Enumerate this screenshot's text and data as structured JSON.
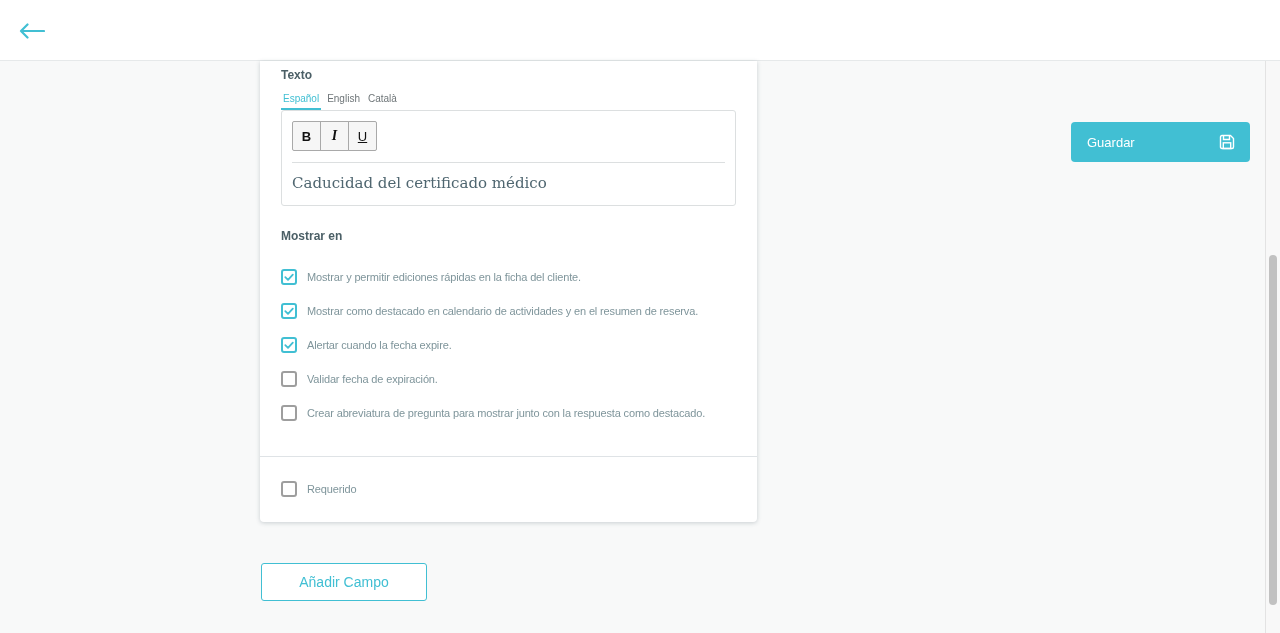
{
  "form_card": {
    "text_section": {
      "title": "Texto",
      "language_tabs": [
        {
          "label": "Español",
          "selected": true
        },
        {
          "label": "English",
          "selected": false
        },
        {
          "label": "Català",
          "selected": false
        }
      ],
      "toolbar": [
        {
          "label": "B",
          "kind": "bold"
        },
        {
          "label": "I",
          "kind": "italic"
        },
        {
          "label": "U",
          "kind": "underline"
        }
      ],
      "content": "Caducidad del certificado médico"
    },
    "display_section": {
      "title": "Mostrar en",
      "options": [
        {
          "label": "Mostrar y permitir ediciones rápidas en la ficha del cliente.",
          "checked": true
        },
        {
          "label": "Mostrar como destacado en calendario de actividades y en el resumen de reserva.",
          "checked": true
        },
        {
          "label": "Alertar cuando la fecha expire.",
          "checked": true
        },
        {
          "label": "Validar fecha de expiración.",
          "checked": false
        },
        {
          "label": "Crear abreviatura de pregunta para mostrar junto con la respuesta como destacado.",
          "checked": false
        }
      ]
    },
    "required": {
      "label": "Requerido",
      "checked": false
    }
  },
  "add_field_button": "Añadir Campo",
  "save_button": "Guardar"
}
